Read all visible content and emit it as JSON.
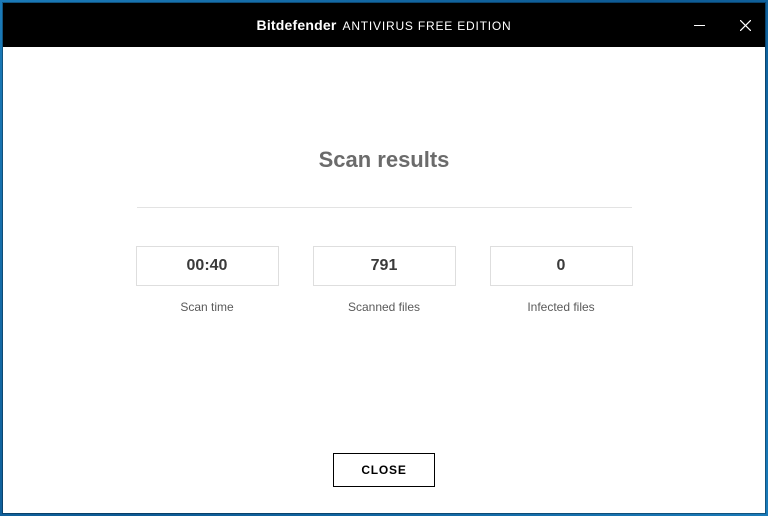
{
  "titlebar": {
    "brand": "Bitdefender",
    "edition": "ANTIVIRUS FREE EDITION"
  },
  "page": {
    "title": "Scan results"
  },
  "stats": {
    "scan_time": {
      "value": "00:40",
      "label": "Scan time"
    },
    "scanned_files": {
      "value": "791",
      "label": "Scanned files"
    },
    "infected_files": {
      "value": "0",
      "label": "Infected files"
    }
  },
  "actions": {
    "close": "CLOSE"
  }
}
